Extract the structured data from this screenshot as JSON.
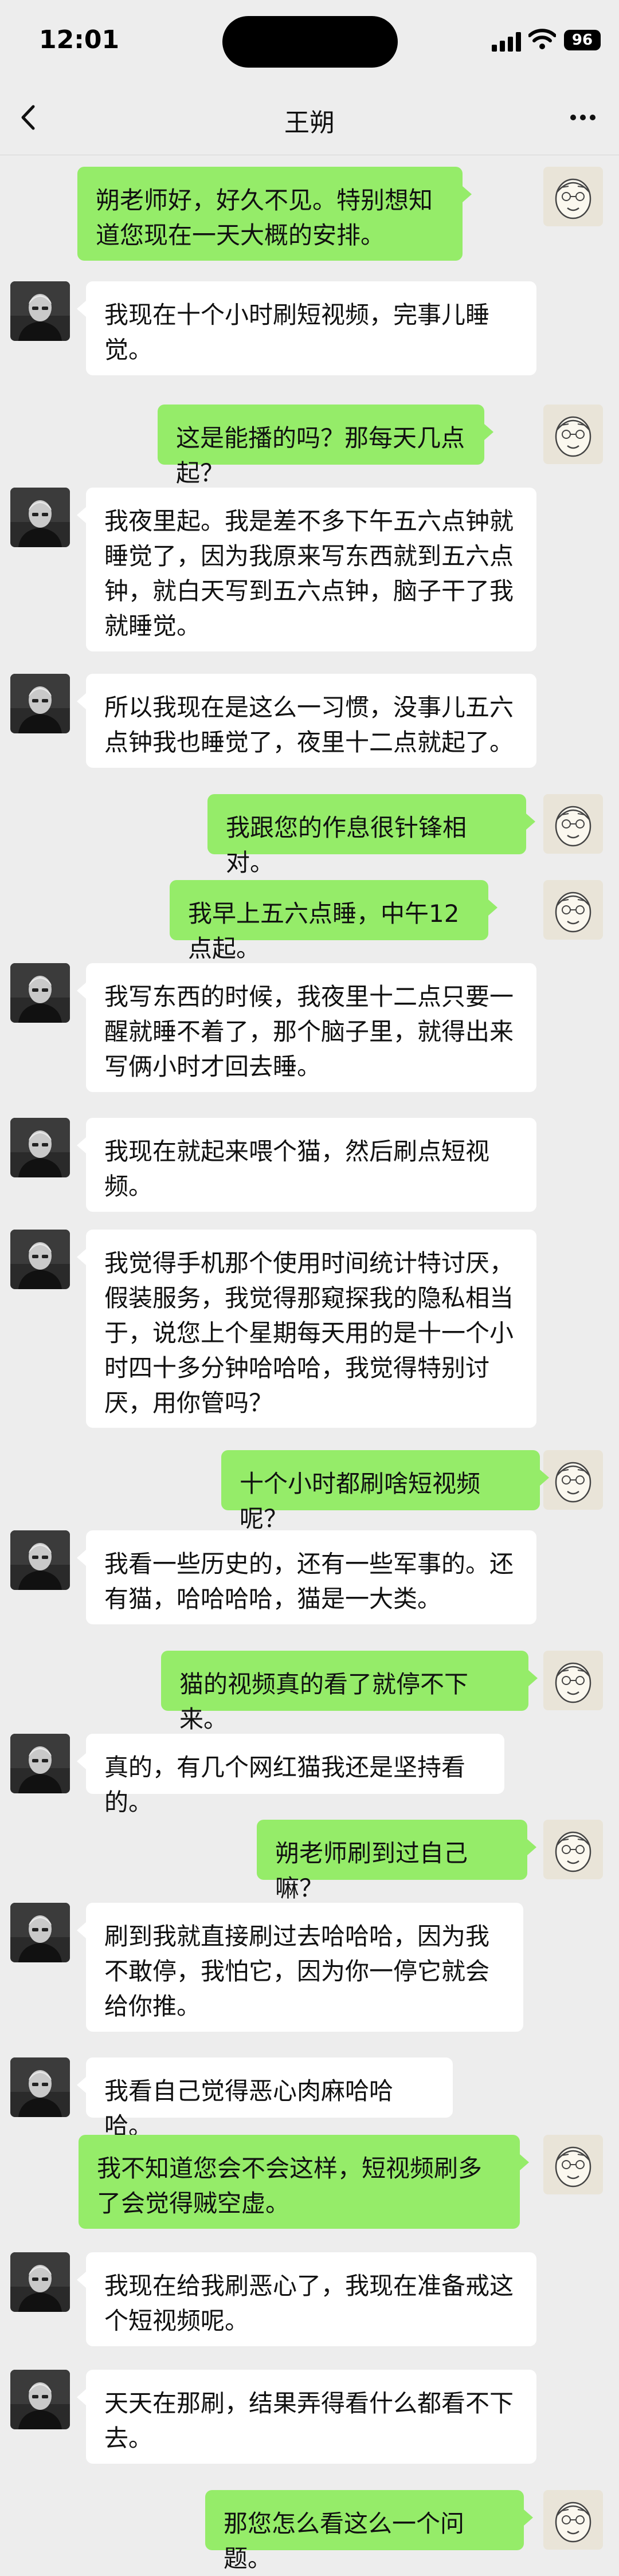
{
  "status": {
    "time": "12:01",
    "battery": "96"
  },
  "header": {
    "title": "王朔"
  },
  "colors": {
    "background": "#ededed",
    "outgoing_bubble": "#95ec69",
    "incoming_bubble": "#ffffff"
  },
  "icons": {
    "back": "chevron-left-icon",
    "more": "more-dots-icon"
  },
  "messages": [
    {
      "from": "me",
      "text": "朔老师好，好久不见。特别想知道您现在一天大概的安排。"
    },
    {
      "from": "wang",
      "text": "我现在十个小时刷短视频，完事儿睡觉。"
    },
    {
      "from": "me",
      "text": "这是能播的吗？那每天几点起？"
    },
    {
      "from": "wang",
      "text": "我夜里起。我是差不多下午五六点钟就睡觉了，因为我原来写东西就到五六点钟，就白天写到五六点钟，脑子干了我就睡觉。"
    },
    {
      "from": "wang",
      "text": "所以我现在是这么一习惯，没事儿五六点钟我也睡觉了，夜里十二点就起了。"
    },
    {
      "from": "me",
      "text": "我跟您的作息很针锋相对。"
    },
    {
      "from": "me",
      "text": "我早上五六点睡，中午12点起。"
    },
    {
      "from": "wang",
      "text": "我写东西的时候，我夜里十二点只要一醒就睡不着了，那个脑子里，就得出来写俩小时才回去睡。"
    },
    {
      "from": "wang",
      "text": "我现在就起来喂个猫，然后刷点短视频。"
    },
    {
      "from": "wang",
      "text": "我觉得手机那个使用时间统计特讨厌，假装服务，我觉得那窥探我的隐私相当于，说您上个星期每天用的是十一个小时四十多分钟哈哈哈，我觉得特别讨厌，用你管吗？"
    },
    {
      "from": "me",
      "text": "十个小时都刷啥短视频呢？"
    },
    {
      "from": "wang",
      "text": "我看一些历史的，还有一些军事的。还有猫，哈哈哈哈，猫是一大类。"
    },
    {
      "from": "me",
      "text": "猫的视频真的看了就停不下来。"
    },
    {
      "from": "wang",
      "text": "真的，有几个网红猫我还是坚持看的。"
    },
    {
      "from": "me",
      "text": "朔老师刷到过自己嘛？"
    },
    {
      "from": "wang",
      "text": "刷到我就直接刷过去哈哈哈，因为我不敢停，我怕它，因为你一停它就会给你推。"
    },
    {
      "from": "wang",
      "text": "我看自己觉得恶心肉麻哈哈哈。"
    },
    {
      "from": "me",
      "text": "我不知道您会不会这样，短视频刷多了会觉得贼空虚。"
    },
    {
      "from": "wang",
      "text": "我现在给我刷恶心了，我现在准备戒这个短视频呢。"
    },
    {
      "from": "wang",
      "text": "天天在那刷，结果弄得看什么都看不下去。"
    },
    {
      "from": "me",
      "text": "那您怎么看这么一个问题。"
    }
  ]
}
